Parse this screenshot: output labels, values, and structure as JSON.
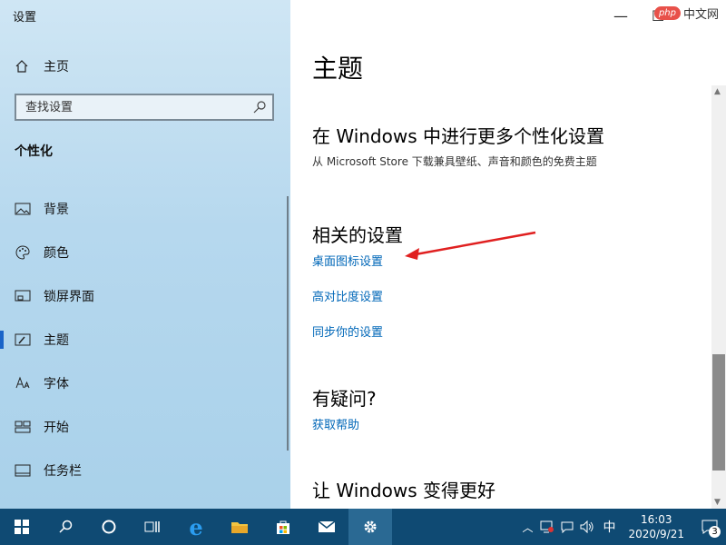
{
  "app": {
    "title": "设置"
  },
  "sidebar": {
    "home_label": "主页",
    "search_placeholder": "查找设置",
    "section_title": "个性化",
    "items": [
      {
        "label": "背景",
        "icon": "image-icon"
      },
      {
        "label": "颜色",
        "icon": "palette-icon"
      },
      {
        "label": "锁屏界面",
        "icon": "lock-screen-icon"
      },
      {
        "label": "主题",
        "icon": "theme-icon",
        "active": true
      },
      {
        "label": "字体",
        "icon": "font-icon"
      },
      {
        "label": "开始",
        "icon": "start-icon"
      },
      {
        "label": "任务栏",
        "icon": "taskbar-icon"
      }
    ]
  },
  "window": {
    "minimize": "—",
    "maximize": "☐"
  },
  "watermark": {
    "php": "php",
    "text": "中文网"
  },
  "main": {
    "title": "主题",
    "more_title": "在 Windows 中进行更多个性化设置",
    "more_desc": "从 Microsoft Store 下载兼具壁纸、声音和颜色的免费主题",
    "related_title": "相关的设置",
    "related_links": [
      "桌面图标设置",
      "高对比度设置",
      "同步你的设置"
    ],
    "question_title": "有疑问?",
    "help_link": "获取帮助",
    "improve_title": "让 Windows 变得更好"
  },
  "taskbar": {
    "ime": "中",
    "time": "16:03",
    "date": "2020/9/21",
    "notification_count": "3"
  },
  "colors": {
    "accent": "#0067b8",
    "taskbar": "#0f4a73",
    "arrow": "#e02020"
  }
}
